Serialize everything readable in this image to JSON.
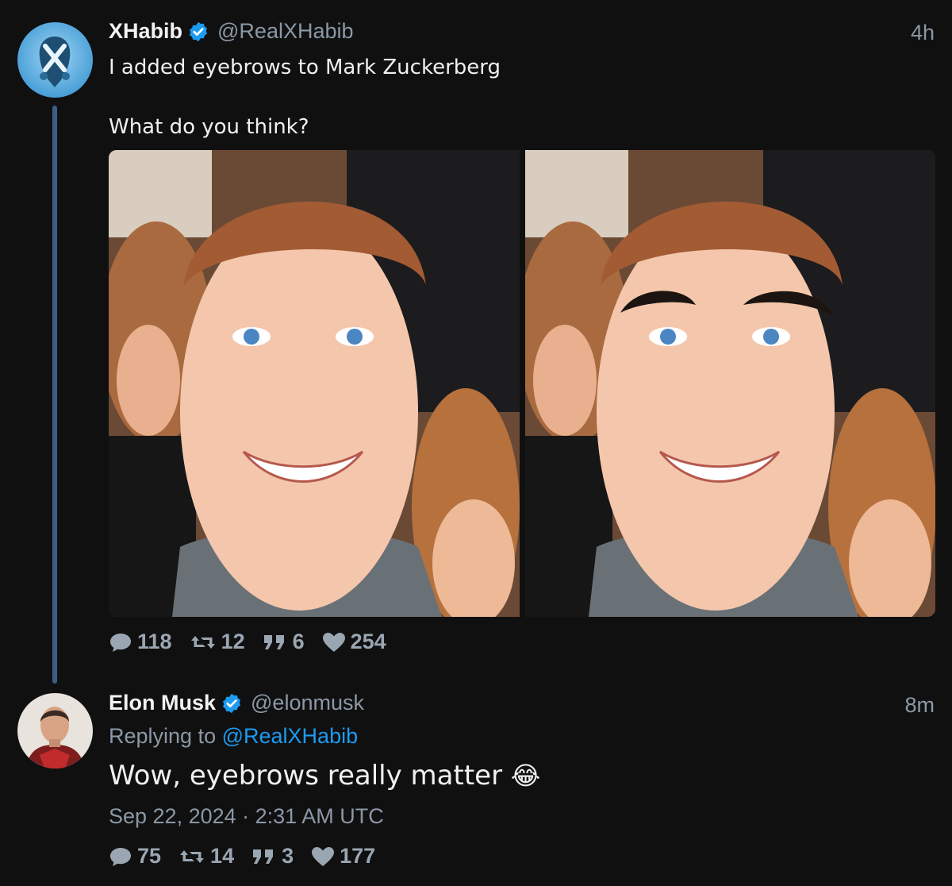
{
  "tweet1": {
    "author_name": "XHabib",
    "author_handle": "@RealXHabib",
    "time": "4h",
    "text_line1": "I added eyebrows to Mark Zuckerberg",
    "text_line2": "What do you think?",
    "stats": {
      "replies": "118",
      "retweets": "12",
      "quotes": "6",
      "likes": "254"
    }
  },
  "tweet2": {
    "author_name": "Elon Musk",
    "author_handle": "@elonmusk",
    "time": "8m",
    "replying_prefix": "Replying to",
    "replying_to": "@RealXHabib",
    "text": "Wow, eyebrows really matter",
    "emoji": "😂",
    "timestamp": "Sep 22, 2024 · 2:31 AM UTC",
    "stats": {
      "replies": "75",
      "retweets": "14",
      "quotes": "3",
      "likes": "177"
    }
  },
  "icons": {
    "verified": "verified-badge-icon",
    "reply": "speech-bubble-icon",
    "retweet": "retweet-icon",
    "quote": "quote-icon",
    "like": "heart-icon"
  },
  "colors": {
    "background": "#101011",
    "link": "#1d9bf0",
    "verified": "#1d9bf0",
    "thread_line": "#3b5f83"
  }
}
